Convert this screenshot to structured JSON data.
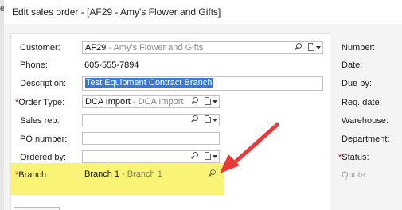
{
  "window": {
    "left_sliver_text": "er",
    "title": "Edit sales order - [AF29 - Amy's Flower and Gifts]"
  },
  "form": {
    "customer": {
      "label": "Customer:",
      "code": "AF29",
      "name": " - Amy's Flower and Gifts"
    },
    "phone": {
      "label": "Phone:",
      "value": "605-555-7894"
    },
    "description": {
      "label": "Description:",
      "value": "Test Equipment Contract Branch"
    },
    "order_type": {
      "required_mark": "*",
      "label": "Order Type:",
      "code": "DCA Import",
      "name": " - DCA Import"
    },
    "sales_rep": {
      "label": "Sales rep:",
      "value": ""
    },
    "po_number": {
      "label": "PO number:",
      "value": ""
    },
    "ordered_by": {
      "label": "Ordered by:",
      "value": ""
    },
    "branch": {
      "required_mark": "*",
      "label": "Branch:",
      "code": "Branch 1",
      "name": " - Branch 1"
    }
  },
  "right_labels": {
    "number": "Number:",
    "date": "Date:",
    "due_by": "Due by:",
    "req_date": "Req. date:",
    "warehouse": "Warehouse:",
    "department": "Department:",
    "status_required_mark": "*",
    "status": "Status:",
    "quote": "Quote:"
  },
  "icons": {
    "lookup": "magnifier-icon",
    "document_dropdown": "document-dropdown-icon",
    "annotation": "red-arrow-annotation"
  },
  "colors": {
    "required": "#c0202a",
    "highlight": "#f8f36a",
    "selection": "#3a78d6",
    "arrow": "#e83a3a"
  }
}
